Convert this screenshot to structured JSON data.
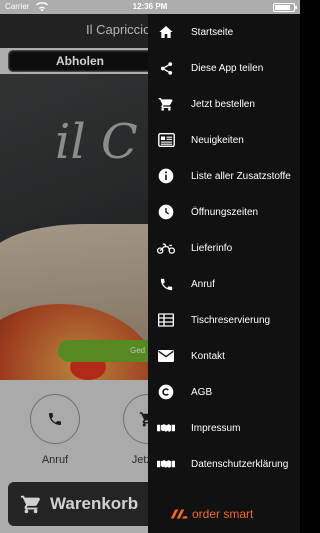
{
  "status_bar": {
    "carrier": "Carrier",
    "time": "12:36 PM",
    "battery_level": 0.85
  },
  "app": {
    "title": "Il Capriccio",
    "segment_active": "Abholen",
    "hero_script": "il C",
    "green_button": "Ged",
    "quick_actions": [
      {
        "label": "Anruf",
        "icon": "phone-icon"
      },
      {
        "label": "Jetzt b",
        "icon": "cart-icon"
      }
    ],
    "cart_label": "Warenkorb"
  },
  "drawer": {
    "items": [
      {
        "label": "Startseite",
        "icon": "home-icon"
      },
      {
        "label": "Diese App teilen",
        "icon": "share-icon"
      },
      {
        "label": "Jetzt bestellen",
        "icon": "cart-icon"
      },
      {
        "label": "Neuigkeiten",
        "icon": "news-icon"
      },
      {
        "label": "Liste aller Zusatzstoffe",
        "icon": "info-icon"
      },
      {
        "label": "Öffnungszeiten",
        "icon": "clock-icon"
      },
      {
        "label": "Lieferinfo",
        "icon": "motorbike-icon"
      },
      {
        "label": "Anruf",
        "icon": "phone-icon"
      },
      {
        "label": "Tischreservierung",
        "icon": "table-icon"
      },
      {
        "label": "Kontakt",
        "icon": "envelope-icon"
      },
      {
        "label": "AGB",
        "icon": "copyright-icon"
      },
      {
        "label": "Impressum",
        "icon": "handshake-icon"
      },
      {
        "label": "Datenschutzerklärung",
        "icon": "handshake-icon"
      }
    ],
    "brand": "order smart",
    "brand_color": "#f26b21"
  }
}
